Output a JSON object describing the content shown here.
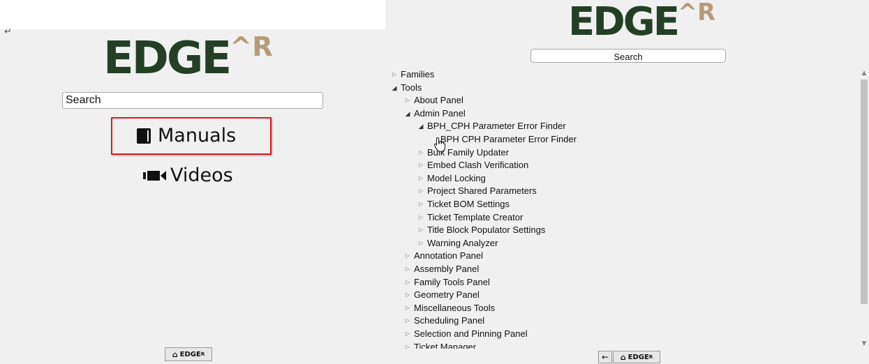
{
  "left": {
    "corner_glyph": "↵",
    "logo": {
      "main": "EDGE",
      "sup": "^R"
    },
    "search": {
      "placeholder": "Search"
    },
    "links": [
      {
        "label": "Manuals",
        "icon": "book-icon",
        "highlighted": true
      },
      {
        "label": "Videos",
        "icon": "video-camera-icon",
        "highlighted": false
      }
    ],
    "home_button": {
      "label": "EDGE",
      "sup": "R"
    }
  },
  "right": {
    "logo": {
      "main": "EDGE",
      "sup": "^R"
    },
    "search": {
      "placeholder": "Search"
    },
    "tree": [
      {
        "label": "Families",
        "depth": 0,
        "expanded": false,
        "leaf": false
      },
      {
        "label": "Tools",
        "depth": 0,
        "expanded": true,
        "leaf": false
      },
      {
        "label": "About Panel",
        "depth": 1,
        "expanded": false,
        "leaf": false
      },
      {
        "label": "Admin Panel",
        "depth": 1,
        "expanded": true,
        "leaf": false
      },
      {
        "label": "BPH_CPH Parameter Error Finder",
        "depth": 2,
        "expanded": true,
        "leaf": false
      },
      {
        "label": "BPH CPH Parameter Error Finder",
        "depth": 3,
        "expanded": false,
        "leaf": true
      },
      {
        "label": "Bulk Family Updater",
        "depth": 2,
        "expanded": false,
        "leaf": false
      },
      {
        "label": "Embed Clash Verification",
        "depth": 2,
        "expanded": false,
        "leaf": false
      },
      {
        "label": "Model Locking",
        "depth": 2,
        "expanded": false,
        "leaf": false
      },
      {
        "label": "Project Shared Parameters",
        "depth": 2,
        "expanded": false,
        "leaf": false
      },
      {
        "label": "Ticket BOM Settings",
        "depth": 2,
        "expanded": false,
        "leaf": false
      },
      {
        "label": "Ticket Template Creator",
        "depth": 2,
        "expanded": false,
        "leaf": false
      },
      {
        "label": "Title Block Populator Settings",
        "depth": 2,
        "expanded": false,
        "leaf": false
      },
      {
        "label": "Warning Analyzer",
        "depth": 2,
        "expanded": false,
        "leaf": false
      },
      {
        "label": "Annotation Panel",
        "depth": 1,
        "expanded": false,
        "leaf": false
      },
      {
        "label": "Assembly Panel",
        "depth": 1,
        "expanded": false,
        "leaf": false
      },
      {
        "label": "Family Tools Panel",
        "depth": 1,
        "expanded": false,
        "leaf": false
      },
      {
        "label": "Geometry Panel",
        "depth": 1,
        "expanded": false,
        "leaf": false
      },
      {
        "label": "Miscellaneous Tools",
        "depth": 1,
        "expanded": false,
        "leaf": false
      },
      {
        "label": "Scheduling Panel",
        "depth": 1,
        "expanded": false,
        "leaf": false
      },
      {
        "label": "Selection and Pinning Panel",
        "depth": 1,
        "expanded": false,
        "leaf": false
      },
      {
        "label": "Ticket Manager",
        "depth": 1,
        "expanded": false,
        "leaf": false
      }
    ],
    "back_button": {
      "icon": "arrow-left-icon",
      "label": "←"
    },
    "home_button": {
      "label": "EDGE",
      "sup": "R"
    }
  }
}
